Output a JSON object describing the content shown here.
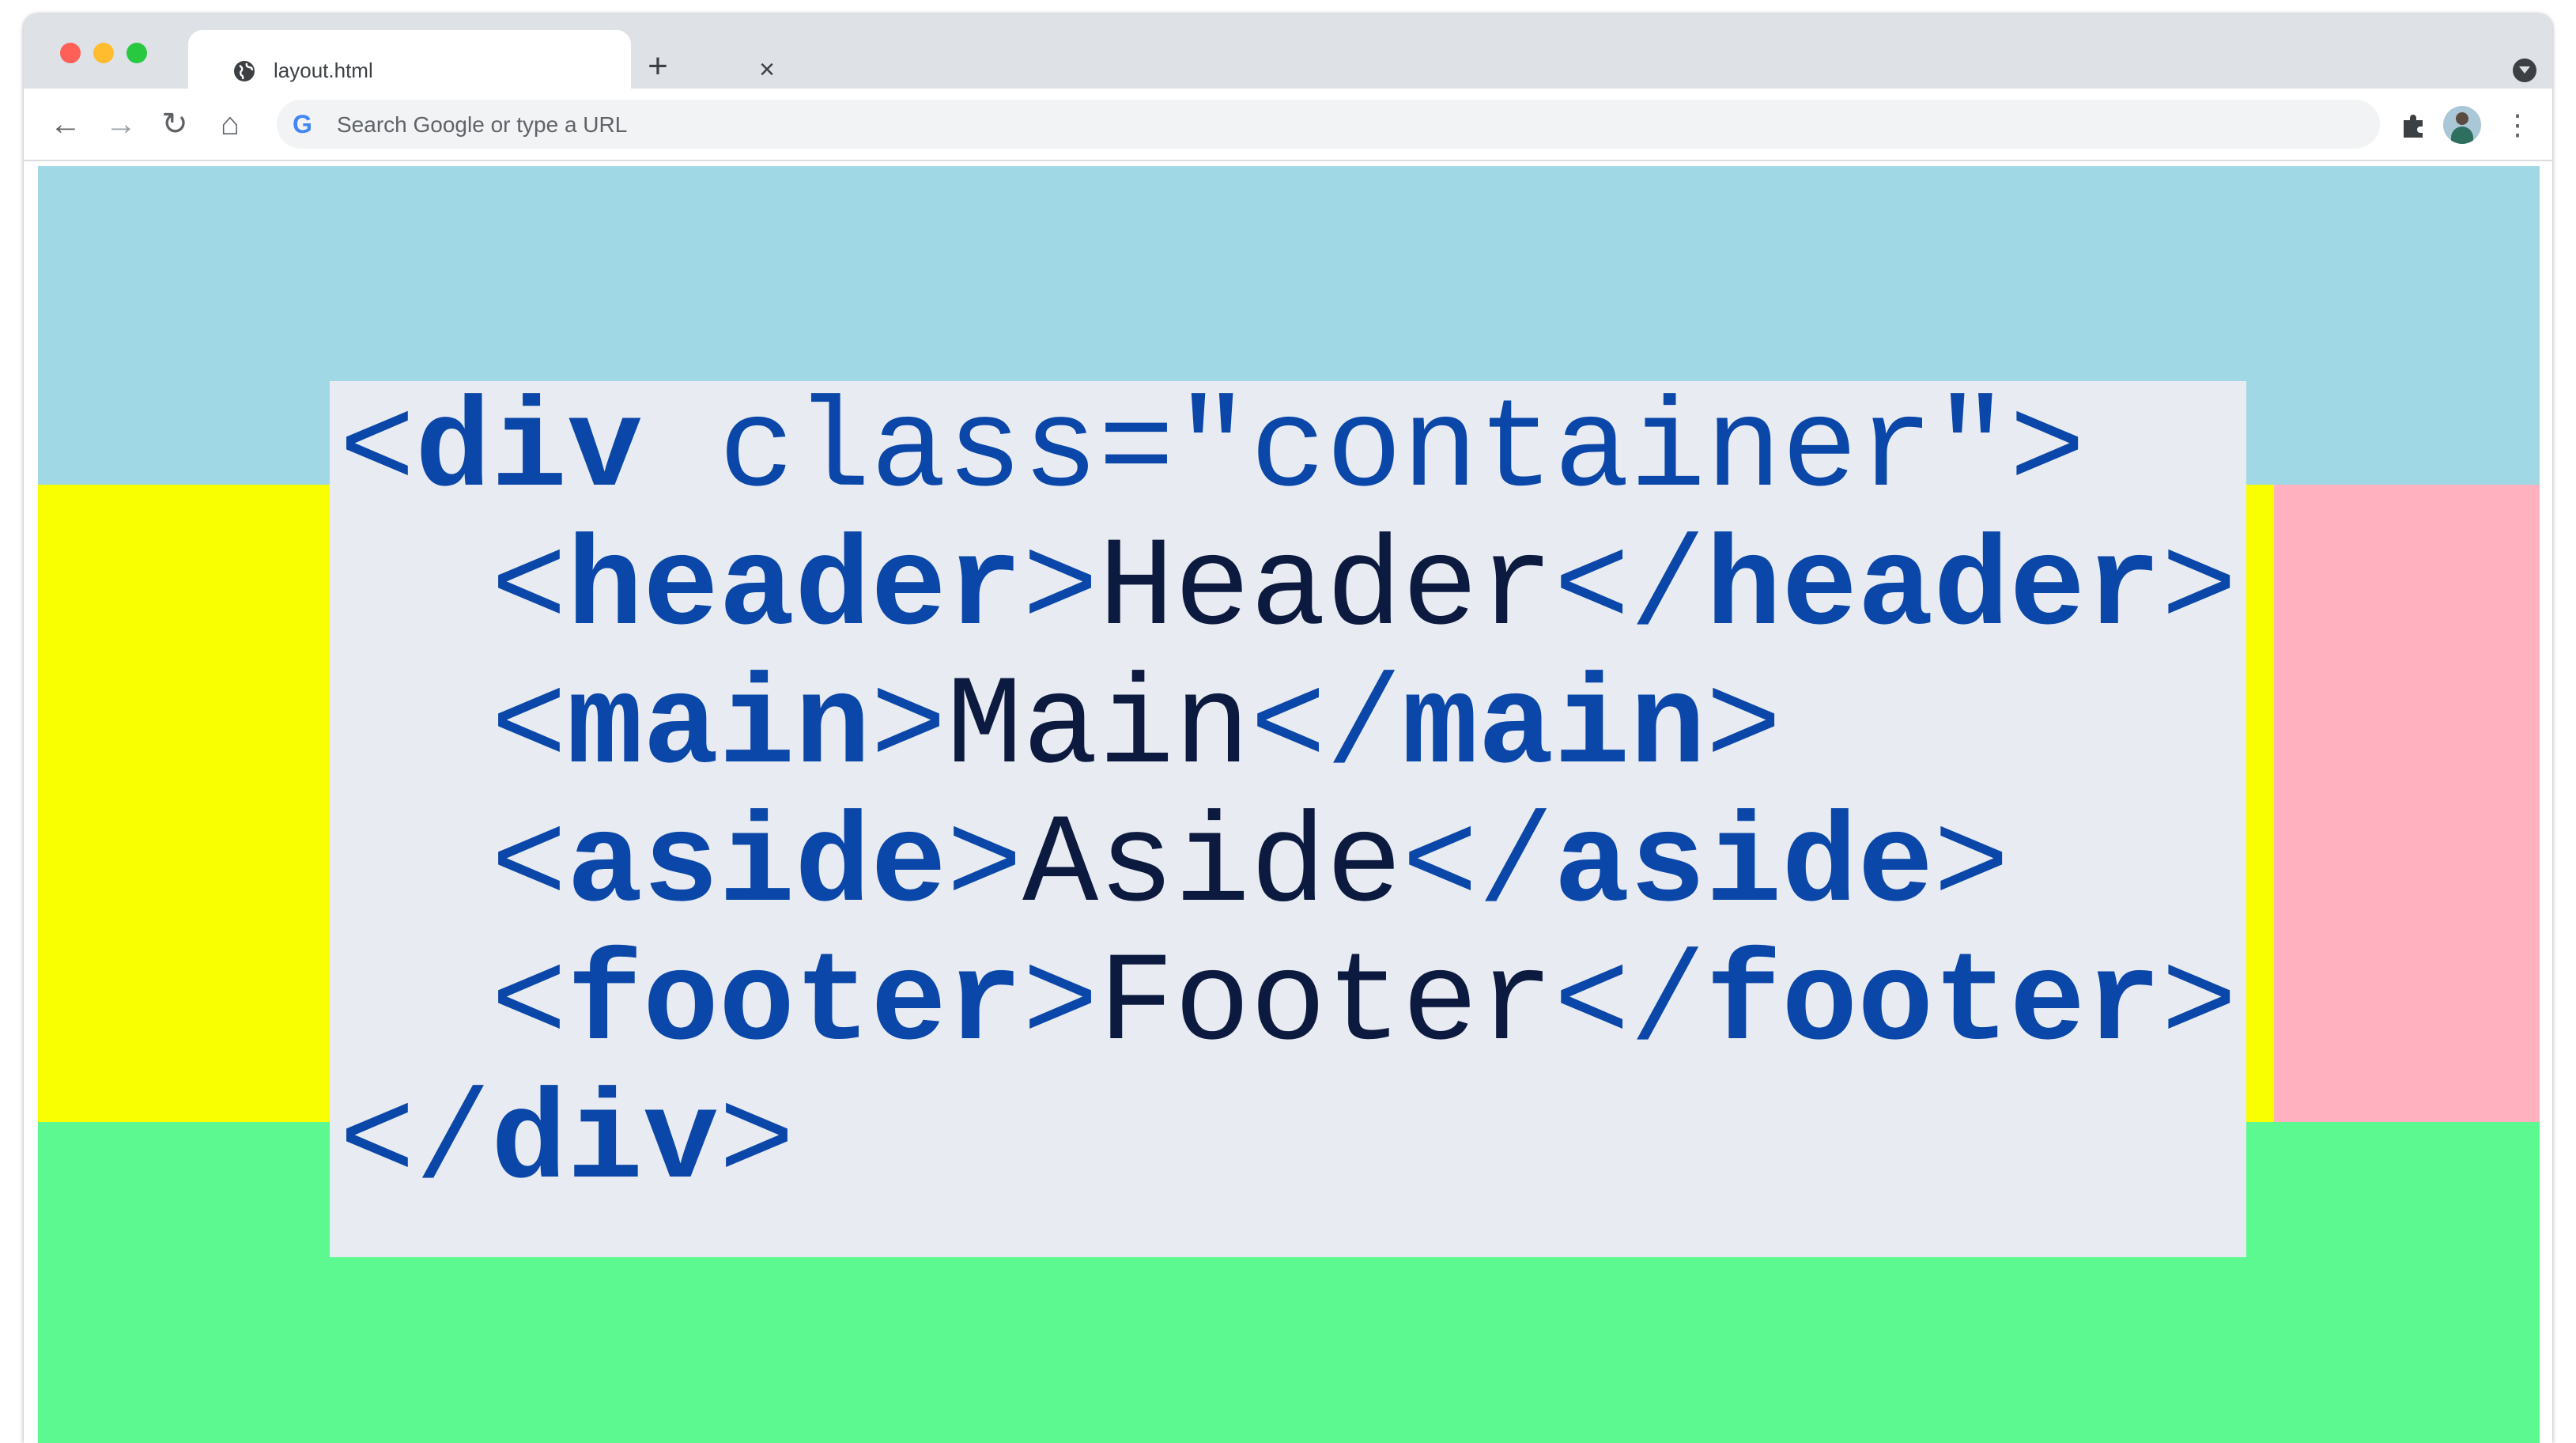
{
  "browser": {
    "tab": {
      "title": "layout.html",
      "close_glyph": "×",
      "icon": "globe-icon"
    },
    "new_tab_glyph": "+",
    "toolbar": {
      "back_glyph": "←",
      "forward_glyph": "→",
      "reload_glyph": "↻",
      "home_glyph": "⌂",
      "search_icon_letter": "G",
      "omnibox_placeholder": "Search Google or type a URL",
      "menu_glyph": "⋮"
    },
    "colors": {
      "tabstrip": "#dee1e6",
      "traffic_red": "#fe5f57",
      "traffic_yellow": "#febc2e",
      "traffic_green": "#28c840"
    }
  },
  "page": {
    "regions": {
      "header_color": "#a1d8e6",
      "main_color": "#f9fe00",
      "aside_color": "#ffb1bf",
      "footer_color": "#5cf990"
    },
    "code": {
      "line1": {
        "open": "<",
        "tag": "div",
        "attr": " class=\"container\"",
        "close": ">"
      },
      "line2": {
        "indent": "  ",
        "open": "<",
        "tag": "header",
        "mid": ">",
        "text": "Header",
        "open2": "</",
        "tag2": "header",
        "close": ">"
      },
      "line3": {
        "indent": "  ",
        "open": "<",
        "tag": "main",
        "mid": ">",
        "text": "Main",
        "open2": "</",
        "tag2": "main",
        "close": ">"
      },
      "line4": {
        "indent": "  ",
        "open": "<",
        "tag": "aside",
        "mid": ">",
        "text": "Aside",
        "open2": "</",
        "tag2": "aside",
        "close": ">"
      },
      "line5": {
        "indent": "  ",
        "open": "<",
        "tag": "footer",
        "mid": ">",
        "text": "Footer",
        "open2": "</",
        "tag2": "footer",
        "close": ">"
      },
      "line6": {
        "open": "</",
        "tag": "div",
        "close": ">"
      },
      "colors": {
        "tag": "#0a47a9",
        "text": "#0d1a40",
        "card": "#e8ebf1"
      }
    }
  }
}
